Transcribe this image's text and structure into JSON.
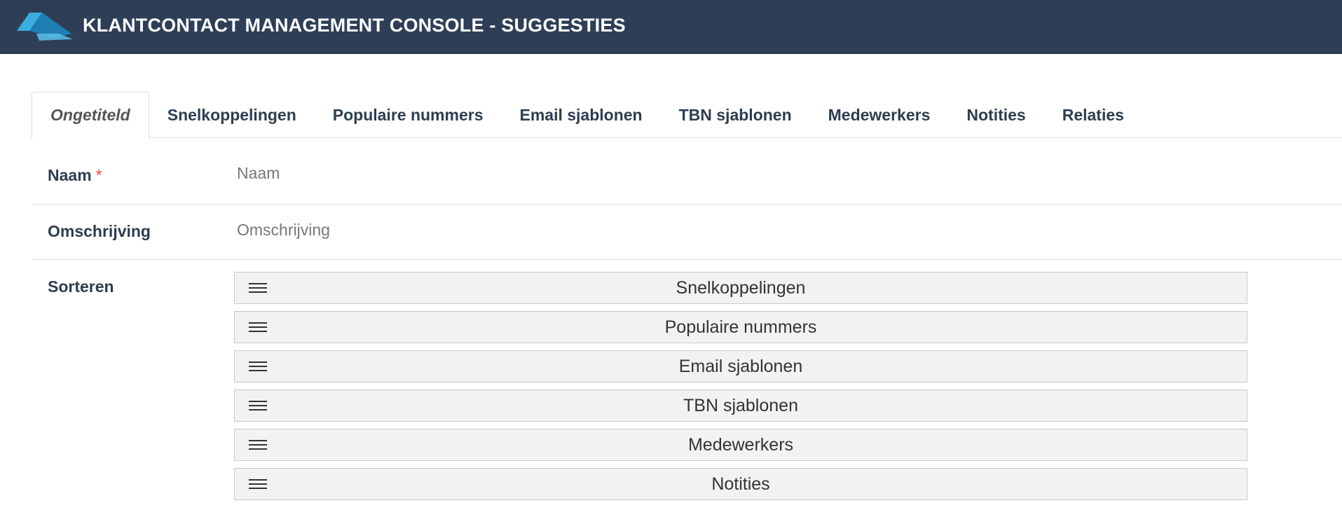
{
  "header": {
    "title": "KLANTCONTACT MANAGEMENT CONSOLE - SUGGESTIES",
    "logo_icon": "logo-icon"
  },
  "tabs": [
    {
      "label": "Ongetiteld",
      "active": true
    },
    {
      "label": "Snelkoppelingen",
      "active": false
    },
    {
      "label": "Populaire nummers",
      "active": false
    },
    {
      "label": "Email sjablonen",
      "active": false
    },
    {
      "label": "TBN sjablonen",
      "active": false
    },
    {
      "label": "Medewerkers",
      "active": false
    },
    {
      "label": "Notities",
      "active": false
    },
    {
      "label": "Relaties",
      "active": false
    }
  ],
  "form": {
    "naam": {
      "label": "Naam",
      "required_mark": "*",
      "value": "",
      "placeholder": "Naam"
    },
    "omschrijving": {
      "label": "Omschrijving",
      "value": "",
      "placeholder": "Omschrijving"
    },
    "sorteren": {
      "label": "Sorteren",
      "items": [
        {
          "label": "Snelkoppelingen"
        },
        {
          "label": "Populaire nummers"
        },
        {
          "label": "Email sjablonen"
        },
        {
          "label": "TBN sjablonen"
        },
        {
          "label": "Medewerkers"
        },
        {
          "label": "Notities"
        }
      ]
    }
  },
  "colors": {
    "header_bg": "#2e3e56",
    "header_text": "#ffffff",
    "text": "#2c3e50",
    "required": "#e74c3c",
    "sort_item_bg": "#f2f2f2",
    "logo_light": "#3aaee0",
    "logo_dark": "#1f7fb4"
  }
}
